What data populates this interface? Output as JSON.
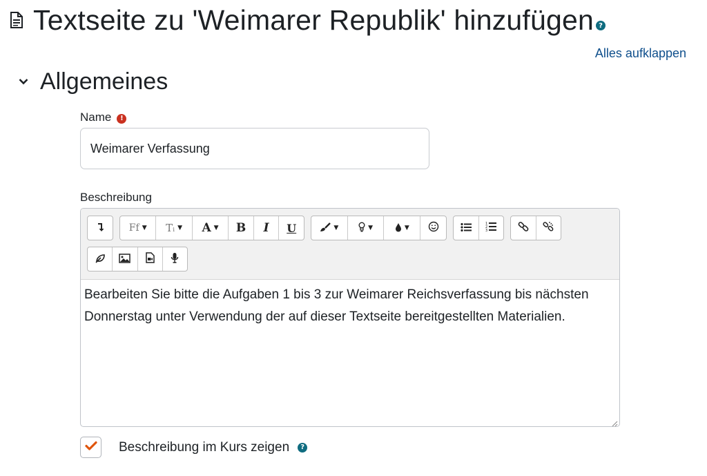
{
  "header": {
    "title": "Textseite zu 'Weimarer Republik' hinzufügen",
    "help_glyph": "?"
  },
  "actions": {
    "expand_all": "Alles aufklappen"
  },
  "section": {
    "title": "Allgemeines"
  },
  "form": {
    "name_label": "Name",
    "required_glyph": "!",
    "name_value": "Weimarer Verfassung",
    "description_label": "Beschreibung",
    "description_text": "Bearbeiten Sie bitte die Aufgaben 1 bis 3 zur Weimarer Reichsverfassung bis nächsten Donnerstag unter Verwendung der auf dieser Textseite bereitgestellten Materialien.",
    "show_in_course_label": "Beschreibung im Kurs zeigen",
    "show_in_course_checked": true,
    "help_glyph": "?"
  },
  "toolbar": {
    "font_family": "Ff",
    "font_size": "Tᵢ",
    "font_style": "A",
    "bold": "B",
    "italic": "I",
    "underline": "U",
    "caret": "▼",
    "icons": [
      "toggle-toolbar-icon",
      "font-family-icon",
      "font-size-icon",
      "font-style-icon",
      "bold-icon",
      "italic-icon",
      "underline-icon",
      "paint-brush-icon",
      "lightbulb-icon",
      "text-color-icon",
      "emoji-icon",
      "bullet-list-icon",
      "numbered-list-icon",
      "link-icon",
      "unlink-icon",
      "recordrtc-icon",
      "image-icon",
      "media-icon",
      "audio-icon"
    ]
  },
  "colors": {
    "accent": "#0f6c80",
    "link": "#0f4f8c",
    "required": "#ca3120",
    "check": "#e0560e",
    "toolbar_bg": "#f1f1f1"
  }
}
